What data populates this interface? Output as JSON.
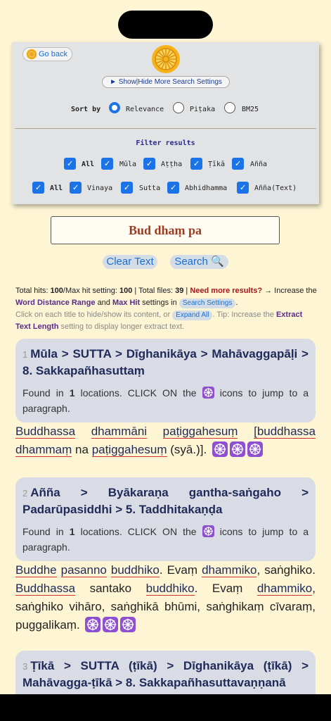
{
  "settings": {
    "go_back": "Go back",
    "toggle_label": "► Show|Hide More Search Settings",
    "sort_by_label": "Sort by",
    "sort_options": [
      "Relevance",
      "Piṭaka",
      "BM25"
    ],
    "filter_title": "Filter results",
    "filter_row1": [
      "All",
      "Mūla",
      "Aṭṭha",
      "Ṭīkā",
      "Añña"
    ],
    "filter_row2": [
      "All",
      "Vinaya",
      "Sutta",
      "Abhidhamma",
      "Añña(Text)"
    ]
  },
  "search": {
    "value": "Bud dhaṃ pa"
  },
  "buttons": {
    "clear": "Clear Text",
    "search": "Search 🔍"
  },
  "info": {
    "total_hits_label": "Total hits:",
    "total_hits": "100",
    "max_hit_label": "/Max hit setting:",
    "max_hit": "100",
    "total_files_label": "| Total files:",
    "total_files": "39",
    "more_results": "Need more results?",
    "increase_the": "→ Increase the",
    "word_distance": "Word Distance Range",
    "and": "and",
    "max_hit_text": "Max Hit",
    "settings_in": "settings in",
    "search_settings_pill": "Search Settings",
    "click_each": "Click on each title to hide/show its content, or",
    "expand_all": "Expand All",
    "tip": ". Tip: Increase the",
    "extract_length": "Extract Text Length",
    "tip_end": "setting to display longer extract text."
  },
  "results": [
    {
      "num": "1",
      "title": "Mūla > SUTTA > Dīghanikāya > Mahāvaggapāḷi > 8. Sakkapañhasuttaṃ",
      "found_prefix": "Found in",
      "locations": "1",
      "found_suffix": "locations. CLICK ON the",
      "found_end": "icons to jump to a paragraph."
    },
    {
      "num": "2",
      "title": "Añña > Byākaraṇa gantha-saṅgaho > Padarūpasiddhi > 5. Taddhitakaṇḍa",
      "found_prefix": "Found in",
      "locations": "1",
      "found_suffix": "locations. CLICK ON the",
      "found_end": "icons to jump to a paragraph."
    },
    {
      "num": "3",
      "title": "Ṭīkā > SUTTA (ṭīkā) > Dīghanikāya (ṭīkā) > Mahāvagga-ṭīkā > 8. Sakkapañhasuttavaṇṇanā"
    }
  ],
  "passage1": {
    "w1": "Buddhassa",
    "w2": "dhammāni",
    "w3": "paṭiggahesuṃ",
    "w4": "[buddhassa dhammaṃ",
    "t1": "na",
    "w5": "paṭiggahesuṃ",
    "t2": "(syā.)]."
  },
  "passage2": {
    "w1": "Buddhe",
    "w2": "pasanno",
    "w3": "buddhiko",
    "t1": ". Evaṃ",
    "w4": "dhammiko",
    "t2": ", saṅghiko.",
    "w5": "Buddhassa",
    "t3": "santako",
    "w6": "buddhiko",
    "t4": ". Evaṃ",
    "w7": "dhammiko",
    "t5": ", saṅghiko vihāro, saṅghikā bhūmi, saṅghikaṃ cīvaraṃ, puggalikaṃ."
  },
  "colors": {
    "accent": "#1b73e8",
    "background": "#fdf5d4",
    "card": "#d9dce4",
    "highlight_underline": "#d23030"
  }
}
